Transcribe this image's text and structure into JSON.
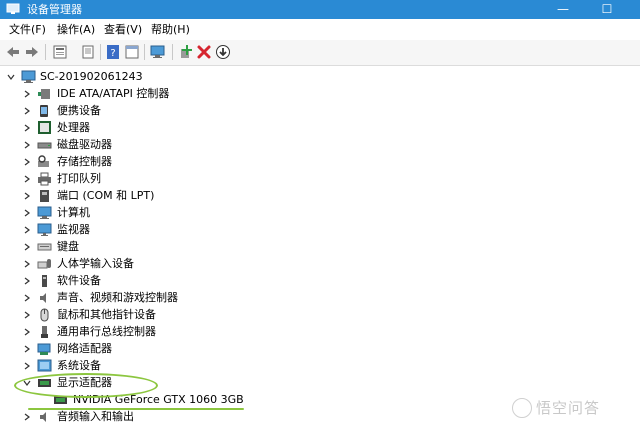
{
  "window": {
    "title": "设备管理器",
    "minimize_glyph": "—",
    "maximize_glyph": "☐",
    "accent": "#2a8ad4"
  },
  "menu": [
    "文件(F)",
    "操作(A)",
    "查看(V)",
    "帮助(H)"
  ],
  "toolbar": {
    "icons": [
      "back-arrow-icon",
      "forward-arrow-icon",
      "properties-icon",
      "update-driver-icon",
      "help-icon",
      "console-icon",
      "scan-hardware-icon",
      "add-driver-icon",
      "uninstall-icon",
      "download-icon"
    ],
    "uninstall_color": "#d6252f"
  },
  "tree": {
    "root": "SC-201902061243",
    "nodes": [
      {
        "label": "IDE ATA/ATAPI 控制器",
        "icon": "ide-controller-icon"
      },
      {
        "label": "便携设备",
        "icon": "portable-device-icon"
      },
      {
        "label": "处理器",
        "icon": "processor-icon"
      },
      {
        "label": "磁盘驱动器",
        "icon": "disk-drive-icon"
      },
      {
        "label": "存储控制器",
        "icon": "storage-controller-icon"
      },
      {
        "label": "打印队列",
        "icon": "printer-icon"
      },
      {
        "label": "端口 (COM 和 LPT)",
        "icon": "port-icon"
      },
      {
        "label": "计算机",
        "icon": "computer-icon"
      },
      {
        "label": "监视器",
        "icon": "monitor-icon"
      },
      {
        "label": "键盘",
        "icon": "keyboard-icon"
      },
      {
        "label": "人体学输入设备",
        "icon": "hid-icon"
      },
      {
        "label": "软件设备",
        "icon": "software-device-icon"
      },
      {
        "label": "声音、视频和游戏控制器",
        "icon": "sound-icon"
      },
      {
        "label": "鼠标和其他指针设备",
        "icon": "mouse-icon"
      },
      {
        "label": "通用串行总线控制器",
        "icon": "usb-icon"
      },
      {
        "label": "网络适配器",
        "icon": "network-adapter-icon"
      },
      {
        "label": "系统设备",
        "icon": "system-device-icon"
      },
      {
        "label": "显示适配器",
        "icon": "display-adapter-icon",
        "expanded": true
      },
      {
        "label": "NVIDIA GeForce GTX 1060 3GB",
        "icon": "gpu-icon",
        "child": true
      },
      {
        "label": "音频输入和输出",
        "icon": "audio-io-icon"
      }
    ]
  },
  "annotation_color": "#8cc63f",
  "watermark": {
    "text": "悟空问答"
  }
}
